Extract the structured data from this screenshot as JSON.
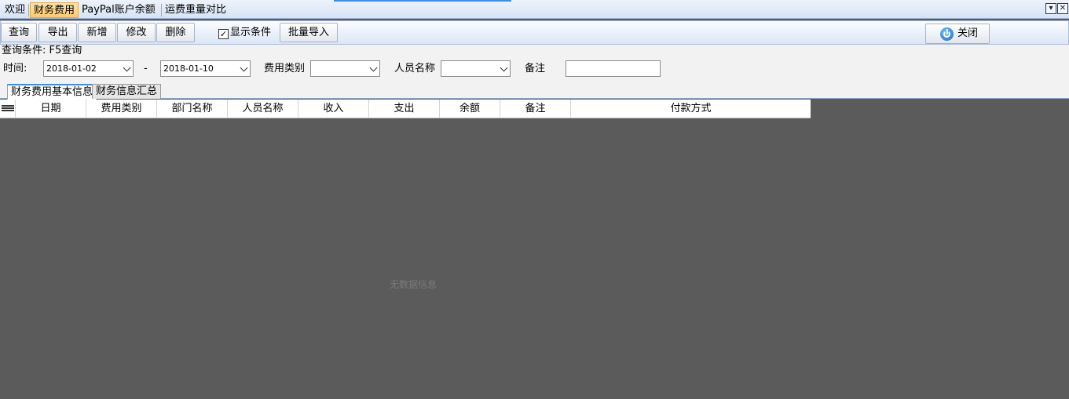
{
  "tabs": [
    {
      "label": "欢迎",
      "active": false
    },
    {
      "label": "财务费用",
      "active": true
    },
    {
      "label": "PayPal账户余额",
      "active": false
    },
    {
      "label": "运费重量对比",
      "active": false
    }
  ],
  "window_buttons": {
    "dropdown": "▾",
    "close": "✕"
  },
  "toolbar": {
    "query": "查询",
    "export": "导出",
    "add": "新增",
    "edit": "修改",
    "delete": "删除",
    "show_conditions": "显示条件",
    "show_conditions_checked": true,
    "batch_import": "批量导入",
    "close": "关闭"
  },
  "query": {
    "title": "查询条件: F5查询",
    "time_label": "时间:",
    "date_from": "2018-01-02",
    "dash": "-",
    "date_to": "2018-01-10",
    "expense_type_label": "费用类别",
    "expense_type_value": "",
    "person_label": "人员名称",
    "person_value": "",
    "remark_label": "备注",
    "remark_value": ""
  },
  "subtabs": [
    {
      "label": "财务费用基本信息",
      "active": true
    },
    {
      "label": "财务信息汇总",
      "active": false
    }
  ],
  "grid": {
    "columns": [
      "日期",
      "费用类别",
      "部门名称",
      "人员名称",
      "收入",
      "支出",
      "余额",
      "备注",
      "付款方式"
    ],
    "empty_message": "无数据信息"
  },
  "colors": {
    "accent": "#3f8ee6",
    "active_tab": "#ffc86a",
    "grid_background": "#5b5b5b"
  }
}
